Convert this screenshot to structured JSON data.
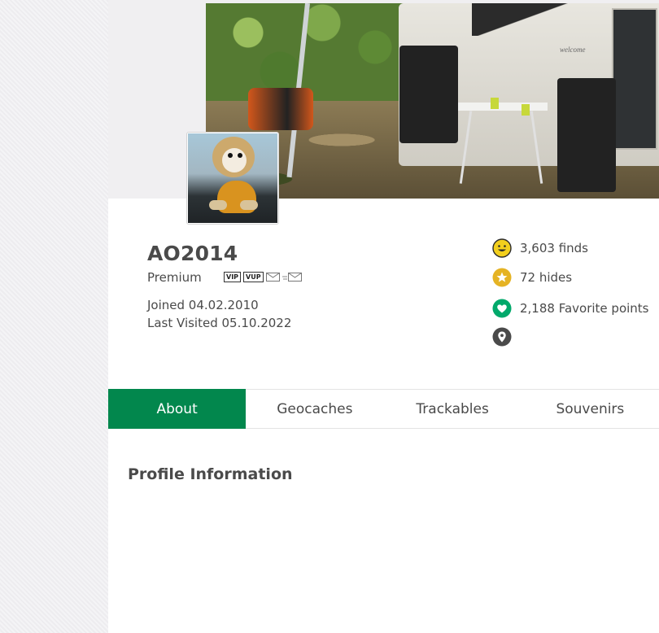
{
  "profile": {
    "username": "AO2014",
    "membership": "Premium",
    "membership_badges": [
      "VIP",
      "VUP"
    ],
    "joined": "Joined 04.02.2010",
    "last_visited": "Last Visited 05.10.2022"
  },
  "stats": {
    "finds": "3,603 finds",
    "hides": "72 hides",
    "favorites": "2,188 Favorite points"
  },
  "banner": {
    "van_brand": "welcome"
  },
  "tabs": [
    {
      "label": "About",
      "active": true
    },
    {
      "label": "Geocaches",
      "active": false
    },
    {
      "label": "Trackables",
      "active": false
    },
    {
      "label": "Souvenirs",
      "active": false
    }
  ],
  "content": {
    "section_title": "Profile Information"
  },
  "colors": {
    "accent_green": "#02874d",
    "finds_icon": "#f2cf1d",
    "hides_icon": "#e5b324",
    "favorites_icon": "#02a96b",
    "location_icon": "#4a4a4a"
  },
  "icons": [
    "smiley-icon",
    "star-icon",
    "heart-icon",
    "location-pin-icon",
    "envelope-icon",
    "forward-envelope-icon"
  ]
}
